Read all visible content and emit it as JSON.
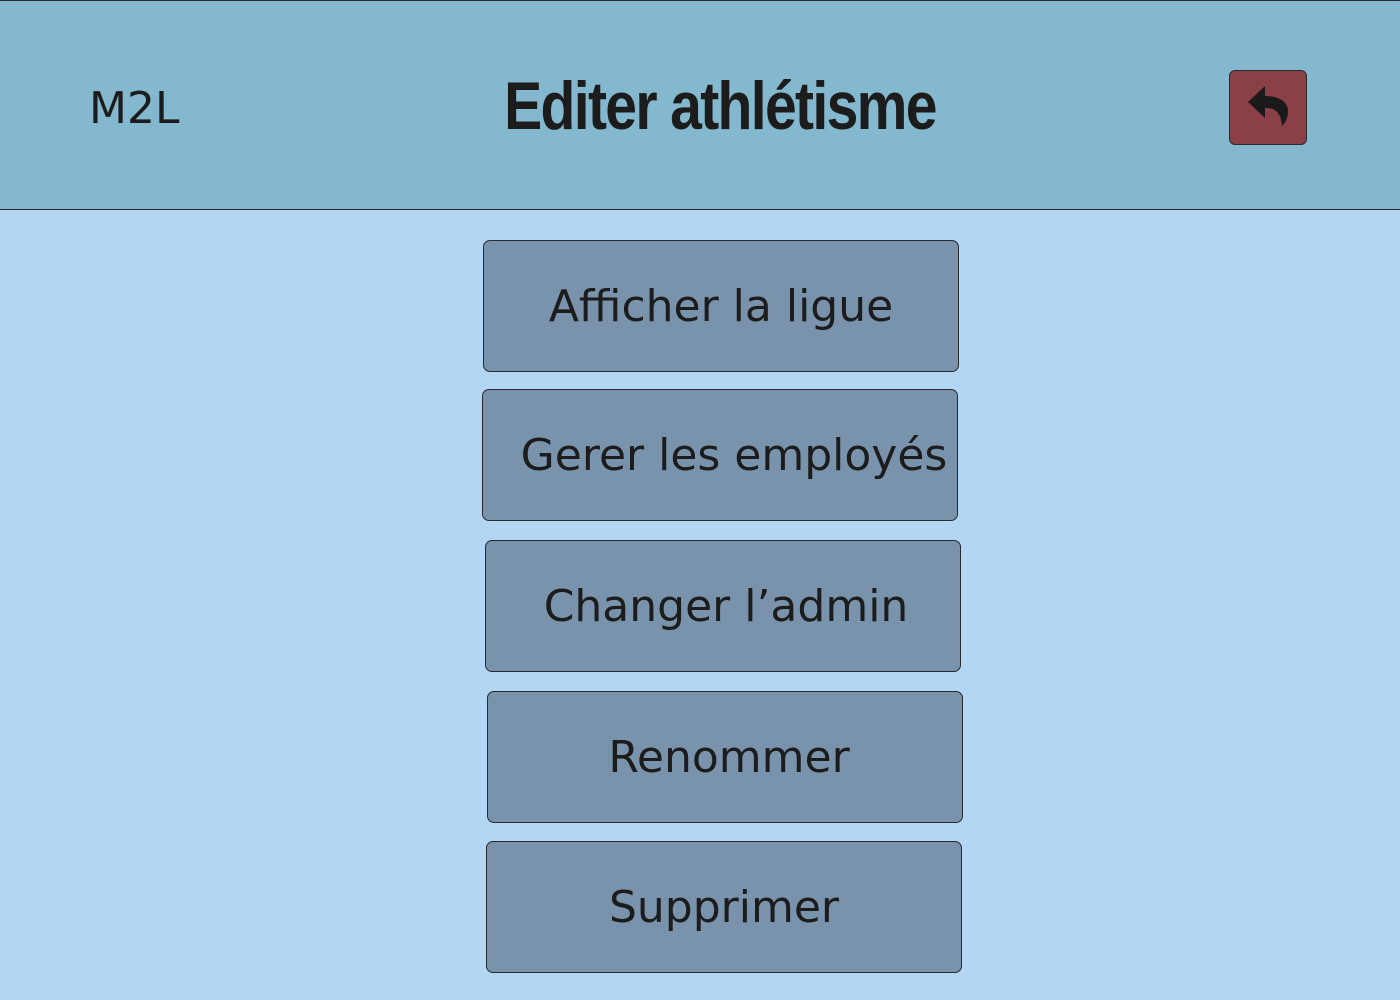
{
  "header": {
    "app_name": "M2L",
    "title": "Editer athlétisme",
    "back_button": {
      "icon": "reply-arrow-icon",
      "color": "#8b3f47"
    }
  },
  "menu": {
    "items": [
      {
        "label": "Afficher la ligue"
      },
      {
        "label": "Gerer les employés"
      },
      {
        "label": "Changer l’admin"
      },
      {
        "label": "Renommer"
      },
      {
        "label": "Supprimer"
      }
    ]
  },
  "colors": {
    "background": "#b3d6f5",
    "header": "#84b8ce",
    "button": "#7893ab",
    "text": "#1c1c1c"
  }
}
